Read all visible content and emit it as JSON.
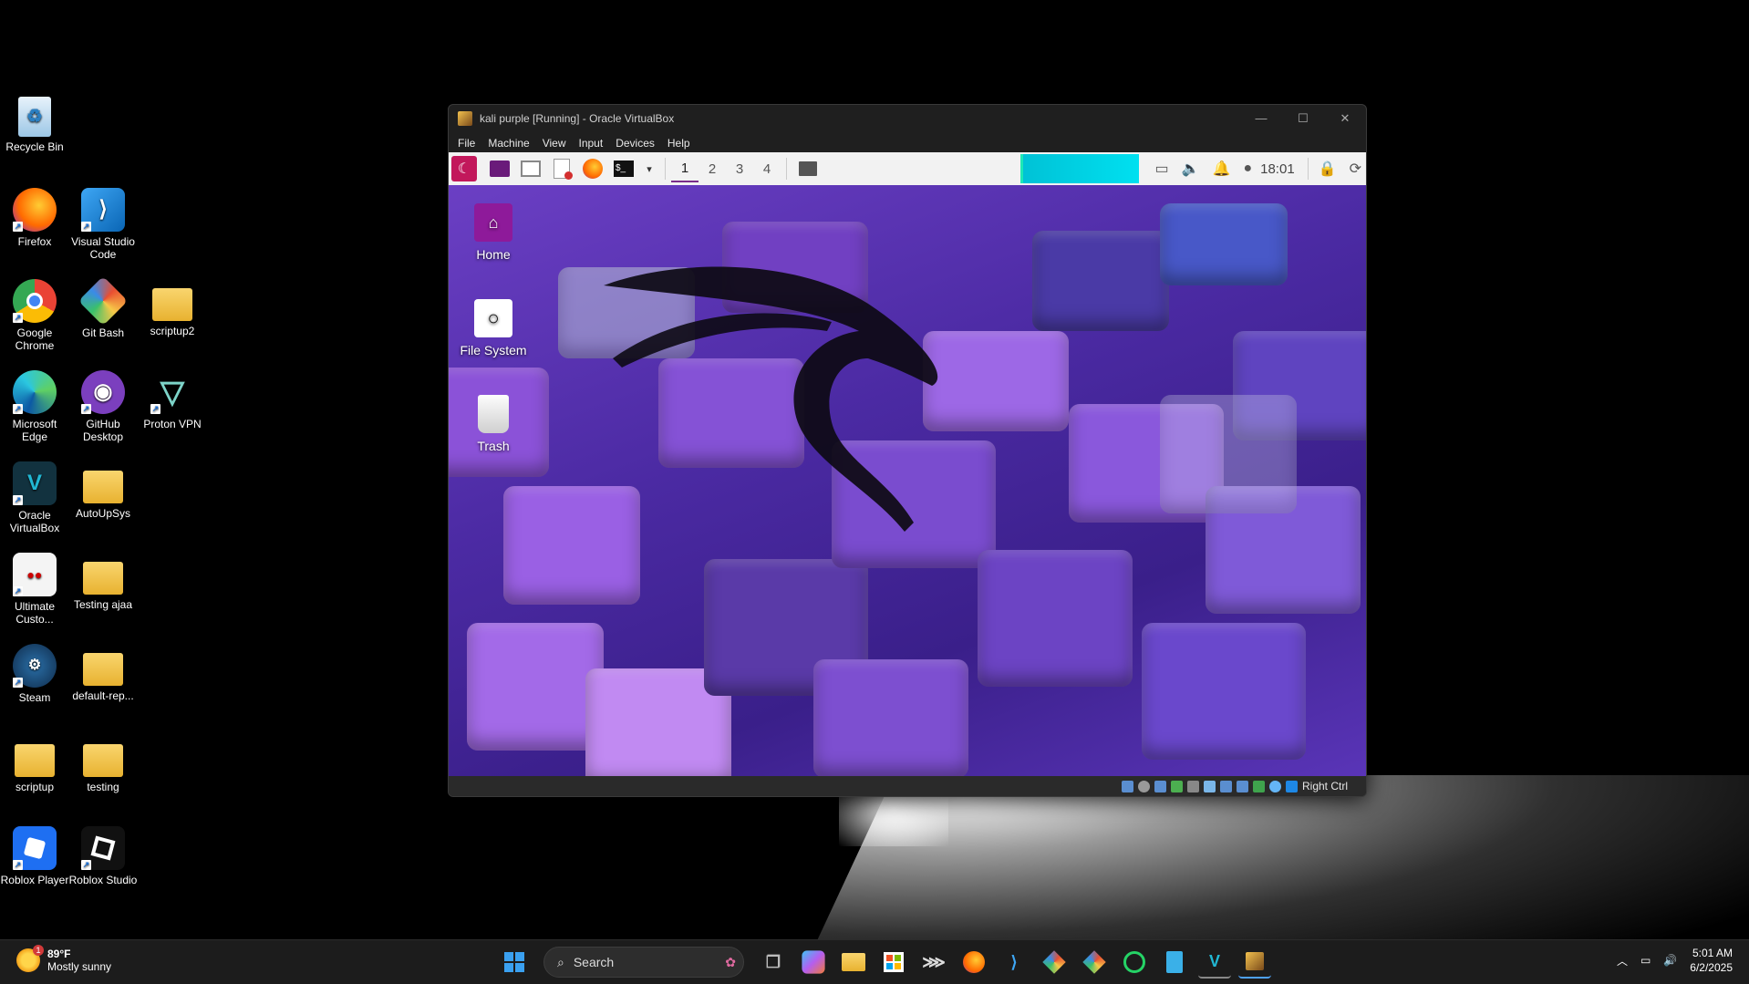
{
  "desktop_icons": [
    {
      "label": "Recycle Bin",
      "icon": "recycle-bin-icon"
    },
    {
      "label": "Firefox",
      "icon": "firefox-icon"
    },
    {
      "label": "Visual Studio Code",
      "icon": "vscode-icon"
    },
    {
      "label": "Google Chrome",
      "icon": "chrome-icon"
    },
    {
      "label": "Git Bash",
      "icon": "git-bash-icon"
    },
    {
      "label": "scriptup2",
      "icon": "folder-icon"
    },
    {
      "label": "Microsoft Edge",
      "icon": "edge-icon"
    },
    {
      "label": "GitHub Desktop",
      "icon": "github-desktop-icon"
    },
    {
      "label": "Proton VPN",
      "icon": "proton-vpn-icon"
    },
    {
      "label": "Oracle VirtualBox",
      "icon": "virtualbox-icon"
    },
    {
      "label": "AutoUpSys",
      "icon": "folder-icon"
    },
    {
      "label": "Ultimate Custo...",
      "icon": "ultimate-custom-icon"
    },
    {
      "label": "Testing ajaa",
      "icon": "folder-icon"
    },
    {
      "label": "Steam",
      "icon": "steam-icon"
    },
    {
      "label": "default-rep...",
      "icon": "folder-icon"
    },
    {
      "label": "scriptup",
      "icon": "folder-icon"
    },
    {
      "label": "testing",
      "icon": "folder-icon"
    },
    {
      "label": "Roblox Player",
      "icon": "roblox-player-icon"
    },
    {
      "label": "Roblox Studio",
      "icon": "roblox-studio-icon"
    }
  ],
  "vbox": {
    "title": "kali purple [Running] - Oracle VirtualBox",
    "menu": [
      "File",
      "Machine",
      "View",
      "Input",
      "Devices",
      "Help"
    ],
    "status_key": "Right Ctrl"
  },
  "kali_panel": {
    "workspaces": [
      "1",
      "2",
      "3",
      "4"
    ],
    "active_workspace": "1",
    "clock": "18:01"
  },
  "guest_icons": [
    {
      "label": "Home",
      "icon": "home-folder-icon"
    },
    {
      "label": "File System",
      "icon": "drive-icon"
    },
    {
      "label": "Trash",
      "icon": "trash-icon"
    }
  ],
  "taskbar": {
    "weather_temp": "89°F",
    "weather_desc": "Mostly sunny",
    "weather_badge": "1",
    "search_label": "Search",
    "time": "5:01 AM",
    "date": "6/2/2025"
  },
  "colors": {
    "kali_accent": "#7a2e8a",
    "cpu_graph": "#00d4e6",
    "guest_wallpaper": "#5b32b8"
  }
}
